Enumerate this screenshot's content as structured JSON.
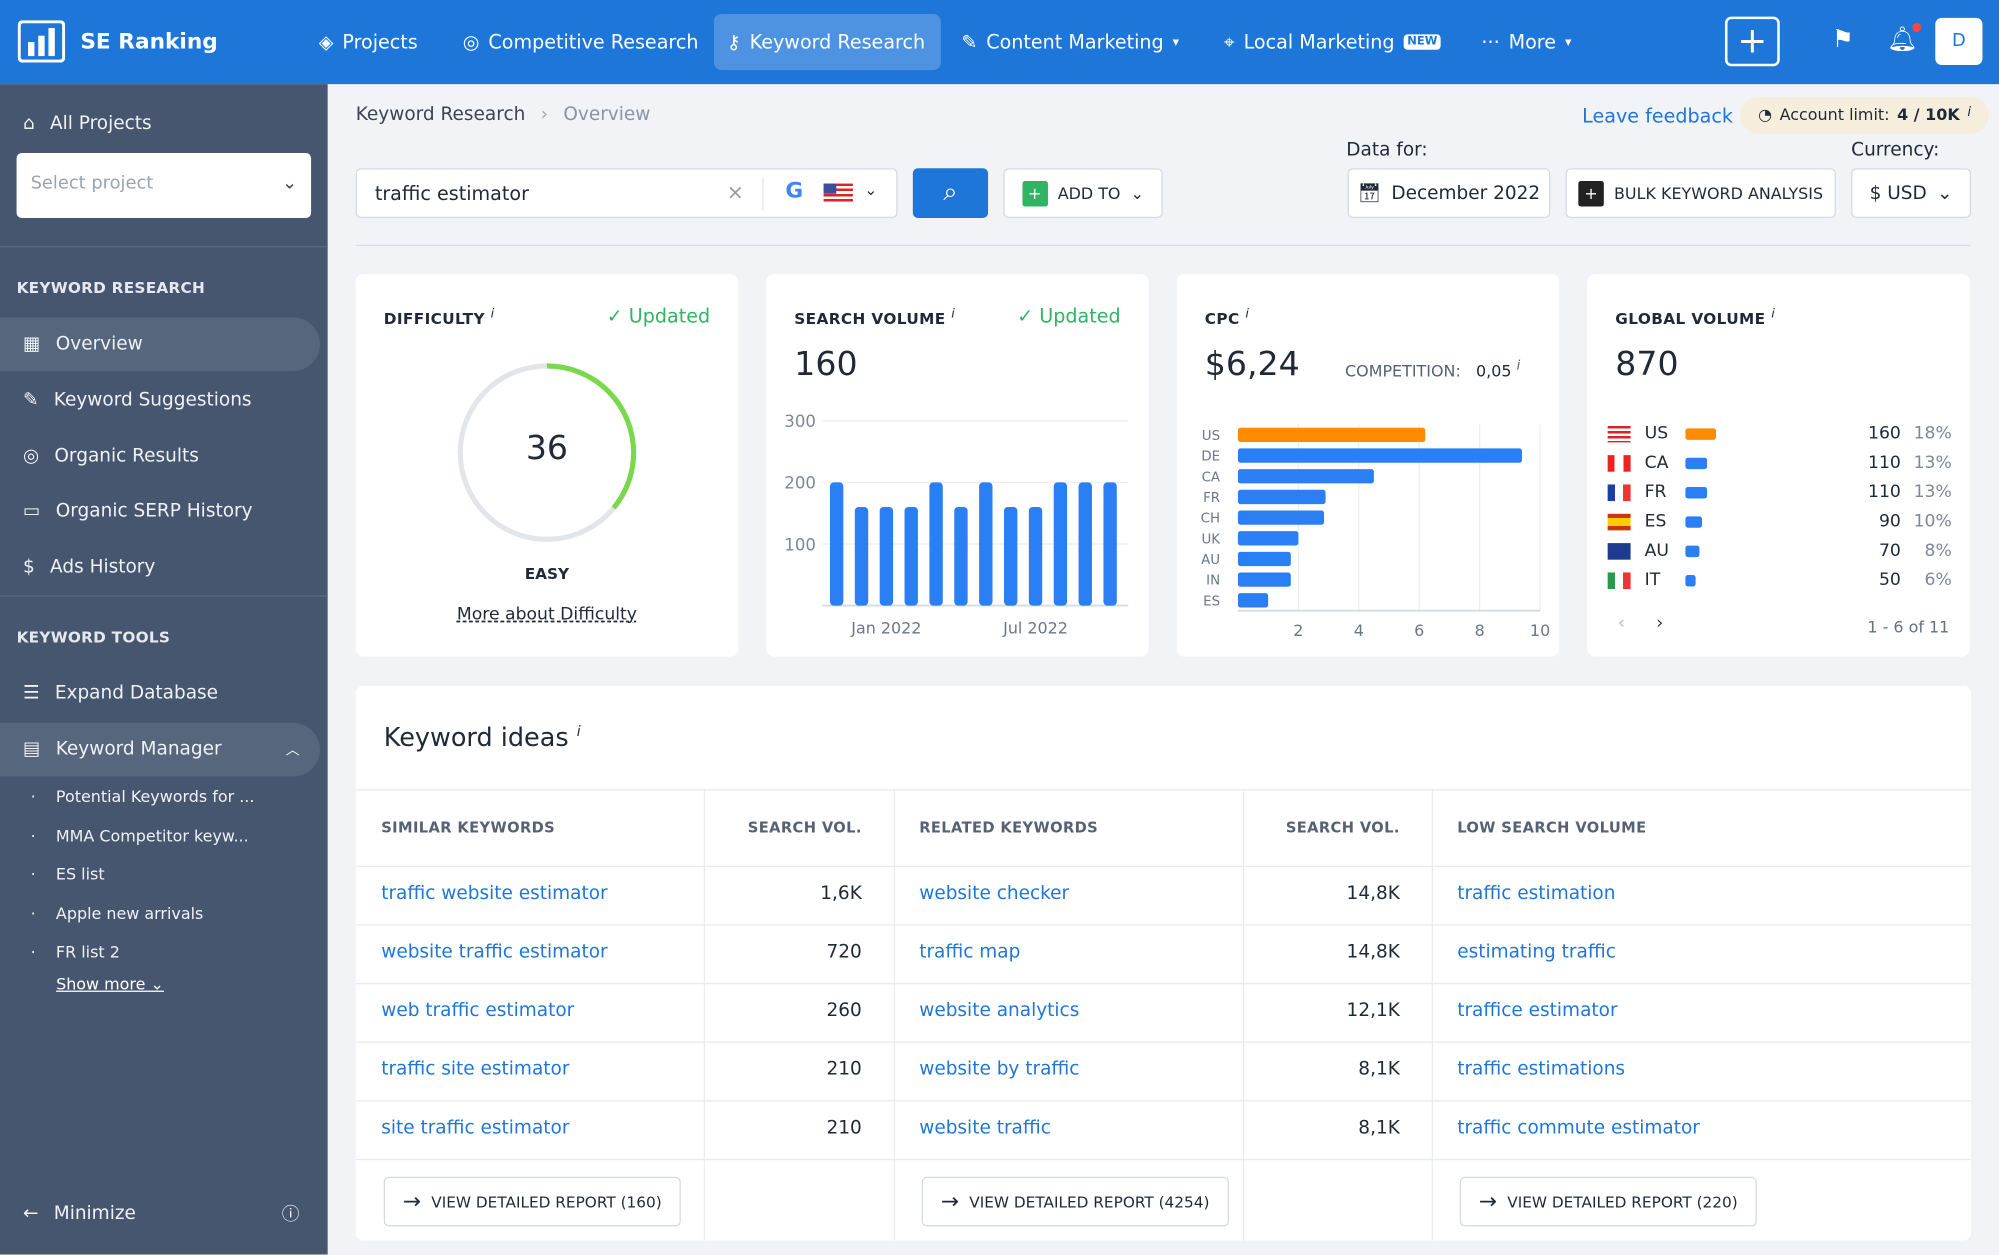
{
  "app": {
    "name": "SE Ranking"
  },
  "topnav": {
    "items": [
      {
        "label": "Projects",
        "icon": "layers-icon"
      },
      {
        "label": "Competitive Research",
        "icon": "target-icon"
      },
      {
        "label": "Keyword Research",
        "icon": "key-icon",
        "active": true
      },
      {
        "label": "Content Marketing",
        "icon": "edit-icon",
        "dropdown": true
      },
      {
        "label": "Local Marketing",
        "icon": "pin-icon",
        "badge": "NEW"
      },
      {
        "label": "More",
        "icon": "dots-icon",
        "dropdown": true
      }
    ],
    "avatar": "D"
  },
  "sidebar": {
    "all_projects": "All Projects",
    "select_placeholder": "Select project",
    "section1": "KEYWORD RESEARCH",
    "items": [
      {
        "label": "Overview",
        "active": true
      },
      {
        "label": "Keyword Suggestions"
      },
      {
        "label": "Organic Results"
      },
      {
        "label": "Organic SERP History"
      },
      {
        "label": "Ads History"
      }
    ],
    "section2": "KEYWORD TOOLS",
    "tools": [
      {
        "label": "Expand Database"
      },
      {
        "label": "Keyword Manager"
      }
    ],
    "lists": [
      "Potential Keywords for ...",
      "MMA Competitor keyw...",
      "ES list",
      "Apple new arrivals",
      "FR list 2"
    ],
    "show_more": "Show more",
    "minimize": "Minimize"
  },
  "breadcrumb": [
    "Keyword Research",
    "Overview"
  ],
  "header": {
    "feedback": "Leave feedback",
    "account_limit": "Account limit:",
    "account_value": "4 / 10K",
    "data_for": "Data for:",
    "currency_label": "Currency:"
  },
  "search": {
    "value": "traffic estimator",
    "add_to": "ADD TO",
    "date": "December 2022",
    "bulk": "BULK KEYWORD ANALYSIS",
    "currency": "$ USD"
  },
  "difficulty": {
    "title": "DIFFICULTY",
    "status": "Updated",
    "value": 36,
    "label": "EASY",
    "link": "More about Difficulty",
    "percent": 36
  },
  "volume": {
    "title": "SEARCH VOLUME",
    "status": "Updated",
    "value": "160"
  },
  "cpc": {
    "title": "CPC",
    "value": "$6,24",
    "competition_label": "COMPETITION:",
    "competition": "0,05"
  },
  "global": {
    "title": "GLOBAL VOLUME",
    "value": "870",
    "pager": "1 - 6 of 11",
    "rows": [
      {
        "code": "US",
        "vol": "160",
        "pct": "18%",
        "share": 18,
        "color": "#ff8c00"
      },
      {
        "code": "CA",
        "vol": "110",
        "pct": "13%",
        "share": 13,
        "color": "#2a7ff5"
      },
      {
        "code": "FR",
        "vol": "110",
        "pct": "13%",
        "share": 13,
        "color": "#2a7ff5"
      },
      {
        "code": "ES",
        "vol": "90",
        "pct": "10%",
        "share": 10,
        "color": "#2a7ff5"
      },
      {
        "code": "AU",
        "vol": "70",
        "pct": "8%",
        "share": 8,
        "color": "#2a7ff5"
      },
      {
        "code": "IT",
        "vol": "50",
        "pct": "6%",
        "share": 6,
        "color": "#2a7ff5"
      }
    ]
  },
  "chart_data": [
    {
      "type": "bar",
      "yticks": [
        100,
        200,
        300
      ],
      "ylim": [
        0,
        300
      ],
      "xtick_labels": [
        {
          "index": 2,
          "label": "Jan 2022"
        },
        {
          "index": 8,
          "label": "Jul 2022"
        }
      ],
      "values": [
        200,
        160,
        160,
        160,
        200,
        160,
        200,
        160,
        160,
        200,
        200,
        200
      ],
      "color": "#2a7ff5",
      "grid": true
    },
    {
      "type": "bar",
      "orientation": "horizontal",
      "categories": [
        "US",
        "DE",
        "CA",
        "FR",
        "CH",
        "UK",
        "AU",
        "IN",
        "ES"
      ],
      "values": [
        6.2,
        9.4,
        4.5,
        2.9,
        2.85,
        2.0,
        1.75,
        1.75,
        1.0
      ],
      "colors": [
        "#ff8c00",
        "#2a7ff5",
        "#2a7ff5",
        "#2a7ff5",
        "#2a7ff5",
        "#2a7ff5",
        "#2a7ff5",
        "#2a7ff5",
        "#2a7ff5"
      ],
      "xticks": [
        2,
        4,
        6,
        8,
        10
      ],
      "xlim": [
        0,
        10
      ],
      "grid": true
    }
  ],
  "ideas": {
    "title": "Keyword ideas",
    "cols": [
      {
        "head": "SIMILAR KEYWORDS",
        "vol_head": "SEARCH VOL.",
        "button": "VIEW DETAILED REPORT (160)",
        "rows": [
          [
            "traffic website estimator",
            "1,6K"
          ],
          [
            "website traffic estimator",
            "720"
          ],
          [
            "web traffic estimator",
            "260"
          ],
          [
            "traffic site estimator",
            "210"
          ],
          [
            "site traffic estimator",
            "210"
          ]
        ]
      },
      {
        "head": "RELATED KEYWORDS",
        "vol_head": "SEARCH VOL.",
        "button": "VIEW DETAILED REPORT (4254)",
        "rows": [
          [
            "website checker",
            "14,8K"
          ],
          [
            "traffic map",
            "14,8K"
          ],
          [
            "website analytics",
            "12,1K"
          ],
          [
            "website by traffic",
            "8,1K"
          ],
          [
            "website traffic",
            "8,1K"
          ]
        ]
      },
      {
        "head": "LOW SEARCH VOLUME",
        "button": "VIEW DETAILED REPORT (220)",
        "rows": [
          [
            "traffic estimation"
          ],
          [
            "estimating traffic"
          ],
          [
            "trafficе estimator"
          ],
          [
            "traffic estimations"
          ],
          [
            "traffic commute estimator"
          ]
        ]
      }
    ]
  }
}
